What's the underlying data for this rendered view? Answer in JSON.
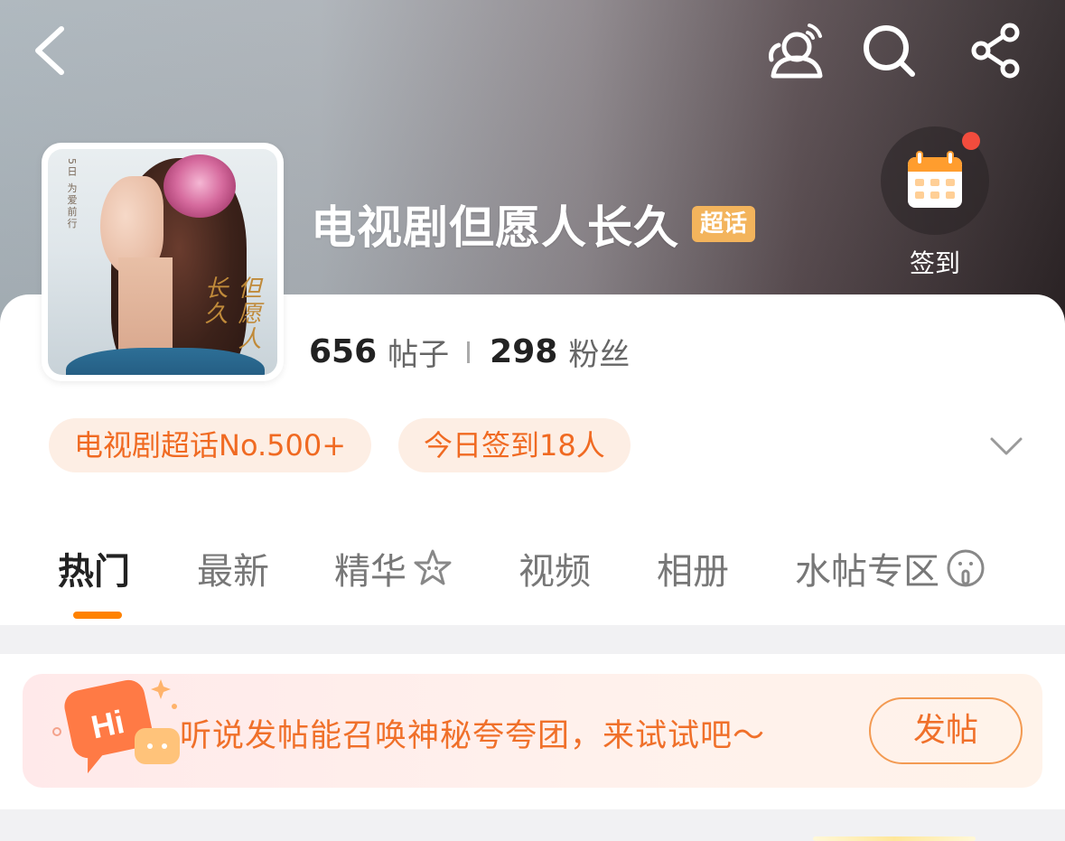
{
  "nav": {
    "back_icon": "chevron-left-icon",
    "actions": [
      "weibo-contacts-icon",
      "search-icon",
      "share-icon"
    ]
  },
  "topic": {
    "title": "电视剧但愿人长久",
    "badge": "超话",
    "poster_caption": "5日 为爱前行",
    "poster_title": "但愿人长久"
  },
  "checkin": {
    "label": "签到",
    "icon": "calendar-icon",
    "has_notification": true
  },
  "stats": {
    "posts_count": "656",
    "posts_label": "帖子",
    "fans_count": "298",
    "fans_label": "粉丝"
  },
  "pills": {
    "rank": "电视剧超话No.500+",
    "today_checkin": "今日签到18人"
  },
  "tabs": [
    {
      "label": "热门",
      "active": true
    },
    {
      "label": "最新",
      "active": false
    },
    {
      "label": "精华",
      "active": false,
      "icon": "star-badge-icon"
    },
    {
      "label": "视频",
      "active": false
    },
    {
      "label": "相册",
      "active": false
    },
    {
      "label": "水帖专区",
      "active": false,
      "icon": "shush-face-icon"
    }
  ],
  "promo": {
    "hi_label": "Hi",
    "text": "听说发帖能召唤神秘夸夸团，来试试吧～",
    "button_label": "发帖"
  },
  "colors": {
    "accent_orange": "#ff8200",
    "pill_text": "#f06a22",
    "badge_gold": "#f3b45c",
    "notification_red": "#f24c3d"
  }
}
